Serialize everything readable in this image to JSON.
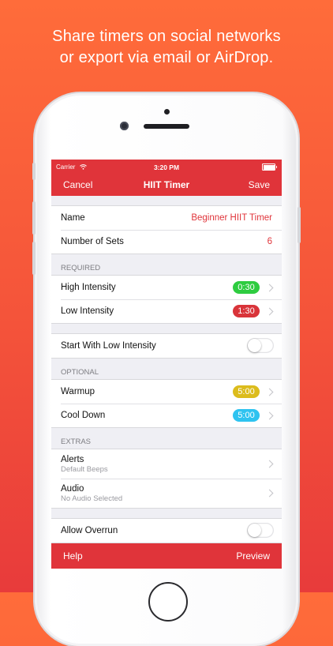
{
  "headline": {
    "line1": "Share timers on social networks",
    "line2": "or export via email or AirDrop."
  },
  "status": {
    "carrier": "Carrier",
    "time": "3:20 PM"
  },
  "nav": {
    "cancel": "Cancel",
    "title": "HIIT Timer",
    "save": "Save"
  },
  "basic": {
    "name_label": "Name",
    "name_value": "Beginner HIIT Timer",
    "sets_label": "Number of Sets",
    "sets_value": "6"
  },
  "required": {
    "header": "REQUIRED",
    "items": [
      {
        "label": "High Intensity",
        "time": "0:30",
        "color": "#2ecc40"
      },
      {
        "label": "Low Intensity",
        "time": "1:30",
        "color": "#d9343a"
      }
    ]
  },
  "start_low": {
    "label": "Start With Low Intensity",
    "on": false
  },
  "optional": {
    "header": "OPTIONAL",
    "items": [
      {
        "label": "Warmup",
        "time": "5:00",
        "color": "#dcbc1c"
      },
      {
        "label": "Cool Down",
        "time": "5:00",
        "color": "#2ec3f0"
      }
    ]
  },
  "extras": {
    "header": "EXTRAS",
    "items": [
      {
        "label": "Alerts",
        "sub": "Default Beeps"
      },
      {
        "label": "Audio",
        "sub": "No Audio Selected"
      }
    ]
  },
  "allow_overrun": {
    "label": "Allow Overrun",
    "on": false
  },
  "toolbar": {
    "help": "Help",
    "preview": "Preview"
  },
  "colors": {
    "accent": "#e0343a",
    "background_top": "#ff6c3a",
    "background_bottom": "#e83b3b"
  }
}
